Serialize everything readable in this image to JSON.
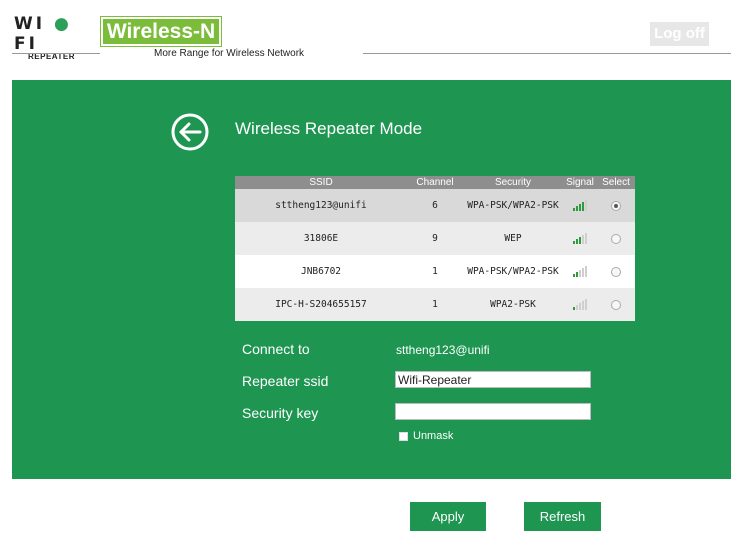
{
  "header": {
    "logo_text": "WI",
    "logo_text2": "FI",
    "logo_sub": "REPEATER",
    "brand": "Wireless-N",
    "tagline": "More Range for Wireless Network",
    "logoff_label": "Log off"
  },
  "panel": {
    "title": "Wireless Repeater Mode",
    "back_icon": "arrow-left-circle-icon"
  },
  "table": {
    "columns": [
      "SSID",
      "Channel",
      "Security",
      "Signal",
      "Select"
    ],
    "rows": [
      {
        "ssid": "sttheng123@unifi",
        "channel": "6",
        "security": "WPA-PSK/WPA2-PSK",
        "signal_bars": 4,
        "selected": true
      },
      {
        "ssid": "31806E",
        "channel": "9",
        "security": "WEP",
        "signal_bars": 3,
        "selected": false
      },
      {
        "ssid": "JNB6702",
        "channel": "1",
        "security": "WPA-PSK/WPA2-PSK",
        "signal_bars": 2,
        "selected": false
      },
      {
        "ssid": "IPC-H-S204655157",
        "channel": "1",
        "security": "WPA2-PSK",
        "signal_bars": 1,
        "selected": false
      }
    ]
  },
  "form": {
    "connect_to_label": "Connect to",
    "connect_to_value": "sttheng123@unifi",
    "repeater_ssid_label": "Repeater ssid",
    "repeater_ssid_value": "Wifi-Repeater",
    "security_key_label": "Security key",
    "security_key_value": "",
    "unmask_label": "Unmask",
    "unmask_checked": false
  },
  "buttons": {
    "apply": "Apply",
    "refresh": "Refresh"
  },
  "colors": {
    "panel_green": "#1e9651",
    "brand_green": "#7bbd3a",
    "signal_on": "#2e9a3e",
    "signal_off": "#cfcfcf"
  }
}
